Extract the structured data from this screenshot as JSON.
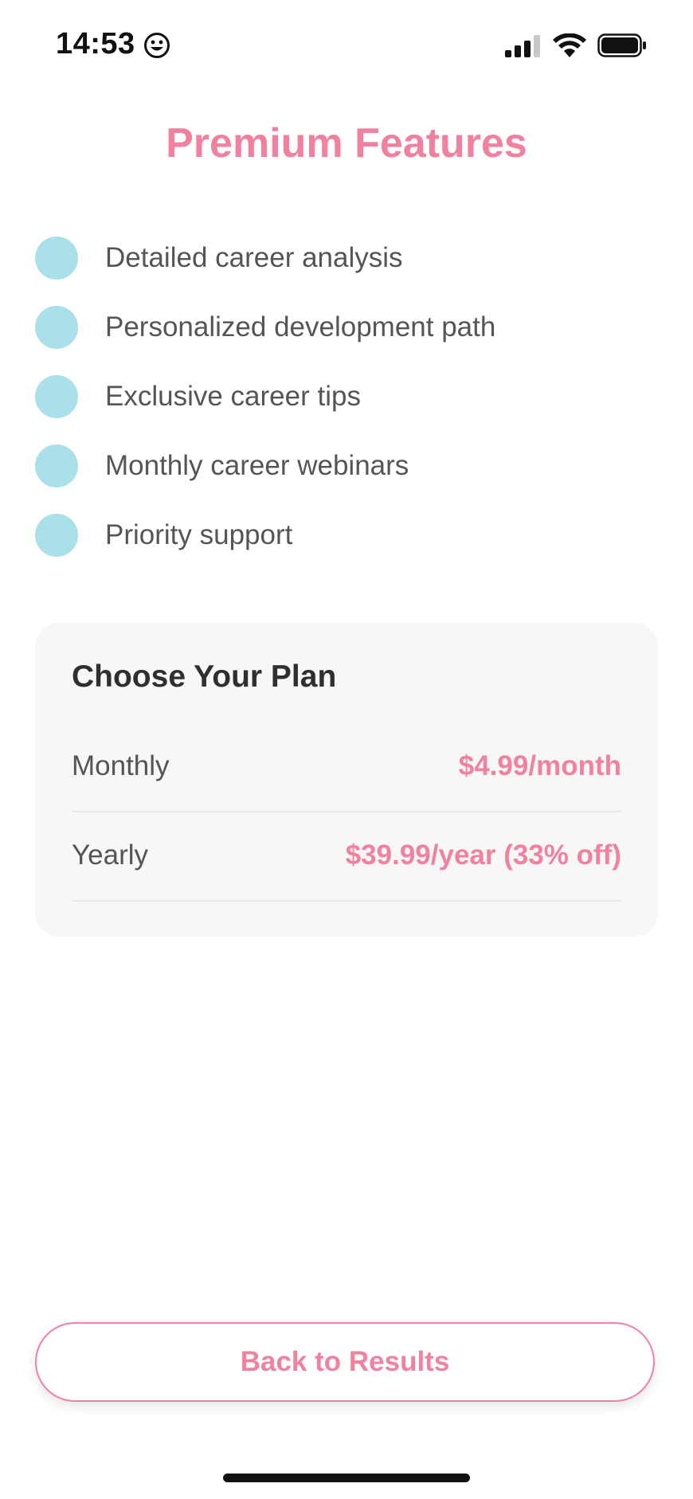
{
  "status_bar": {
    "time": "14:53",
    "emoji_icon": "smiling-face-icon",
    "signal_icon": "cellular-signal-icon",
    "wifi_icon": "wifi-icon",
    "battery_icon": "battery-icon"
  },
  "title": "Premium Features",
  "features": [
    {
      "label": "Detailed career analysis"
    },
    {
      "label": "Personalized development path"
    },
    {
      "label": "Exclusive career tips"
    },
    {
      "label": "Monthly career webinars"
    },
    {
      "label": "Priority support"
    }
  ],
  "plan": {
    "title": "Choose Your Plan",
    "options": [
      {
        "name": "Monthly",
        "price": "$4.99/month"
      },
      {
        "name": "Yearly",
        "price": "$39.99/year (33% off)"
      }
    ]
  },
  "back_button_label": "Back to Results",
  "colors": {
    "accent": "#f2819f",
    "bullet": "#a9e0e9",
    "card_bg": "#f7f7f7",
    "text": "#555555",
    "heading": "#2f2f2f"
  }
}
